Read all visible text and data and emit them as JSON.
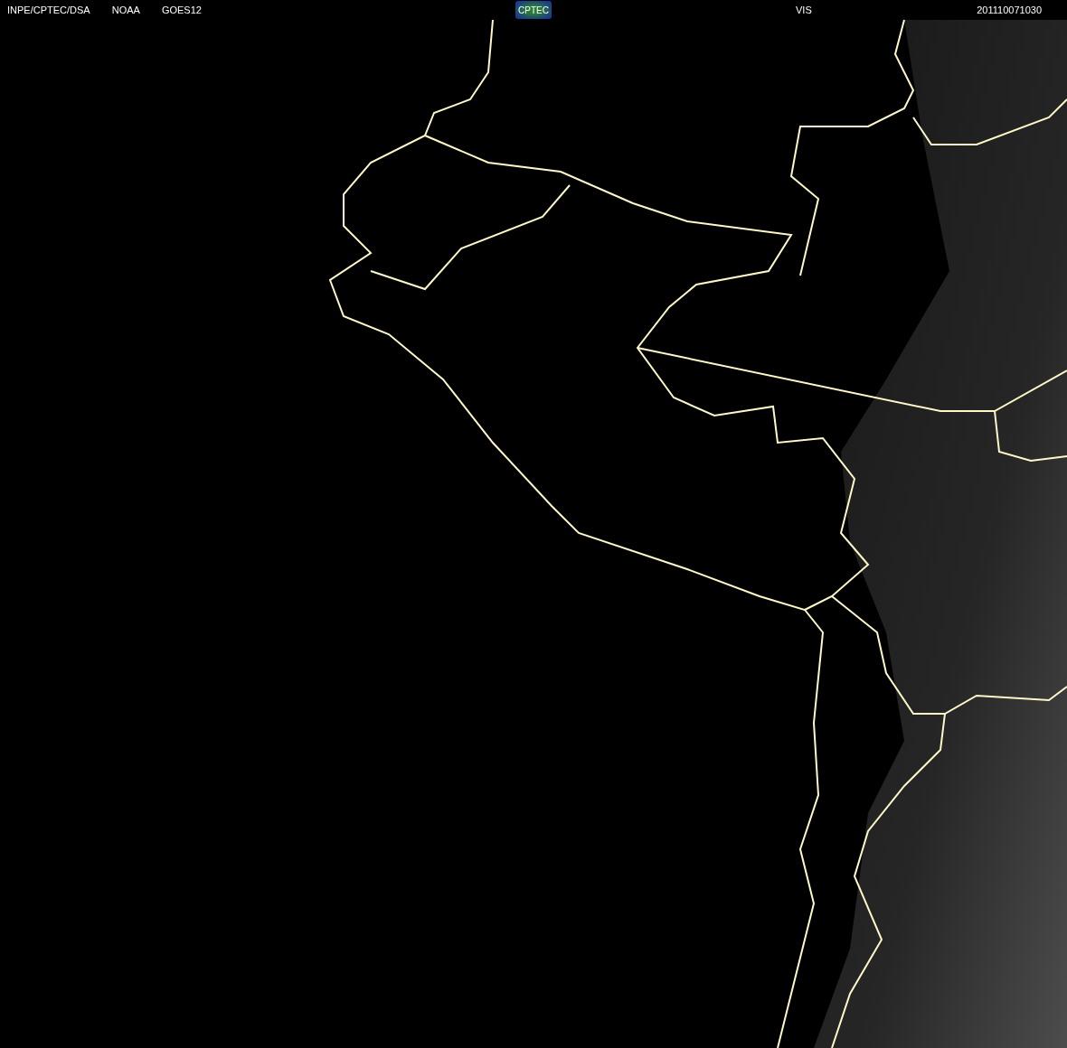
{
  "header": {
    "labels": [
      "INPE/CPTEC/DSA",
      "NOAA",
      "GOES12"
    ],
    "logo": "CPTEC",
    "channel": "VIS",
    "timestamp": "201110071030"
  }
}
